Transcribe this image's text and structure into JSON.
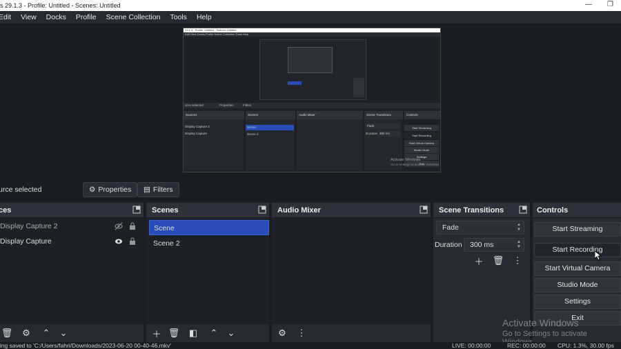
{
  "window": {
    "title": "s 29.1.3 - Profile: Untitled - Scenes: Untitled",
    "minimize_icon": "minimize-icon",
    "restore_icon": "restore-icon"
  },
  "menu": [
    "Edit",
    "View",
    "Docks",
    "Profile",
    "Scene Collection",
    "Tools",
    "Help"
  ],
  "nested_preview": {
    "title": "29.1.3 - Profile: Untitled - Scenes: Untitled",
    "menu": "Edit  View  Docks  Profile  Scene Collection  Tools  Help",
    "source_selected": "urce selected",
    "properties": "Properties",
    "filters": "Filters",
    "docks": [
      "Sources",
      "Scenes",
      "Audio Mixer",
      "Scene Transitions",
      "Controls"
    ],
    "sources": [
      "Display Capture 2",
      "Display Capture"
    ],
    "scenes": [
      "Scene",
      "Scene 2"
    ],
    "transition": "Fade",
    "duration_label": "Duration",
    "duration": "300 ms",
    "controls": [
      "Start Streaming",
      "Start Recording",
      "Start Virtual Camera",
      "Studio Mode",
      "Settings",
      "Exit"
    ],
    "watermark1": "Activate Windows",
    "watermark2": "Go to Settings to activate Windows."
  },
  "source_toolbar": {
    "no_source": "urce selected",
    "properties_label": "Properties",
    "filters_label": "Filters"
  },
  "sources_dock": {
    "title": "ces",
    "items": [
      {
        "name": "Display Capture 2",
        "visible": false
      },
      {
        "name": "Display Capture",
        "visible": true
      }
    ]
  },
  "scenes_dock": {
    "title": "Scenes",
    "items": [
      "Scene",
      "Scene 2"
    ],
    "selected": "Scene"
  },
  "audio_dock": {
    "title": "Audio Mixer"
  },
  "transitions_dock": {
    "title": "Scene Transitions",
    "transition": "Fade",
    "duration_label": "Duration",
    "duration": "300 ms"
  },
  "controls_dock": {
    "title": "Controls",
    "buttons": [
      "Start Streaming",
      "Start Recording",
      "Start Virtual Camera",
      "Studio Mode",
      "Settings",
      "Exit"
    ]
  },
  "watermark": {
    "line1": "Activate Windows",
    "line2": "Go to Settings to activate Windows."
  },
  "statusbar": {
    "message": "ling saved to 'C:/Users/fahri/Downloads/2023-06-20 00-40-46.mkv'",
    "live": "LIVE: 00:00:00",
    "rec": "REC: 00:00:00",
    "cpu": "CPU: 1.3%, 30.00 fps"
  },
  "colors": {
    "selected_scene": "#284cb8",
    "background": "#1b1d24",
    "dock": "#272a33"
  }
}
